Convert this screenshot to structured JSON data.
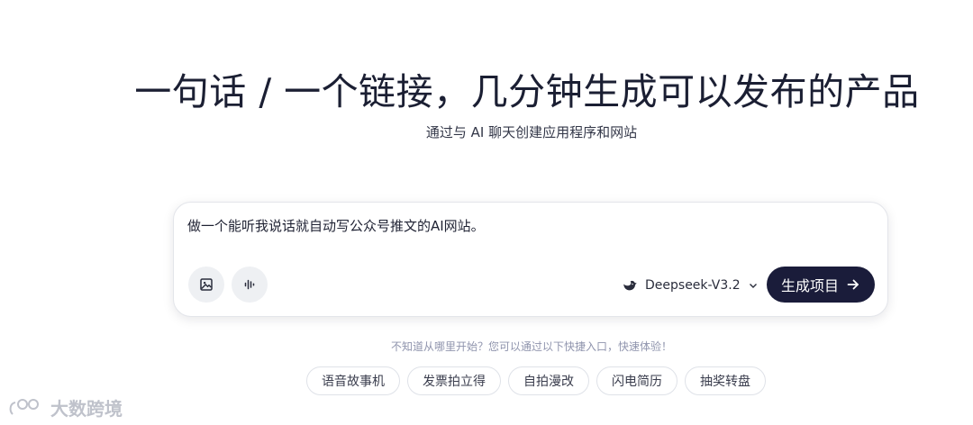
{
  "hero": {
    "title": "一句话 / 一个链接，几分钟生成可以发布的产品",
    "subtitle": "通过与 AI 聊天创建应用程序和网站"
  },
  "prompt": {
    "value": "做一个能听我说话就自动写公众号推文的AI网站。"
  },
  "toolbar": {
    "image_icon": "image-icon",
    "voice_icon": "voice-waveform-icon",
    "model_icon": "deepseek-whale-icon",
    "model_label": "Deepseek-V3.2",
    "chevron_icon": "chevron-down-icon",
    "generate_label": "生成项目",
    "arrow_icon": "arrow-right-icon"
  },
  "hint": "不知道从哪里开始？您可以通过以下快捷入口，快速体验！",
  "quick_entries": [
    {
      "label": "语音故事机"
    },
    {
      "label": "发票拍立得"
    },
    {
      "label": "自拍漫改"
    },
    {
      "label": "闪电简历"
    },
    {
      "label": "抽奖转盘"
    }
  ],
  "watermark": {
    "text": "大数跨境"
  },
  "colors": {
    "primary_button": "#1a1c3a",
    "title_text": "#1b1f33",
    "hint_text": "#8f94ad",
    "tool_button_bg": "#eef0f3"
  }
}
